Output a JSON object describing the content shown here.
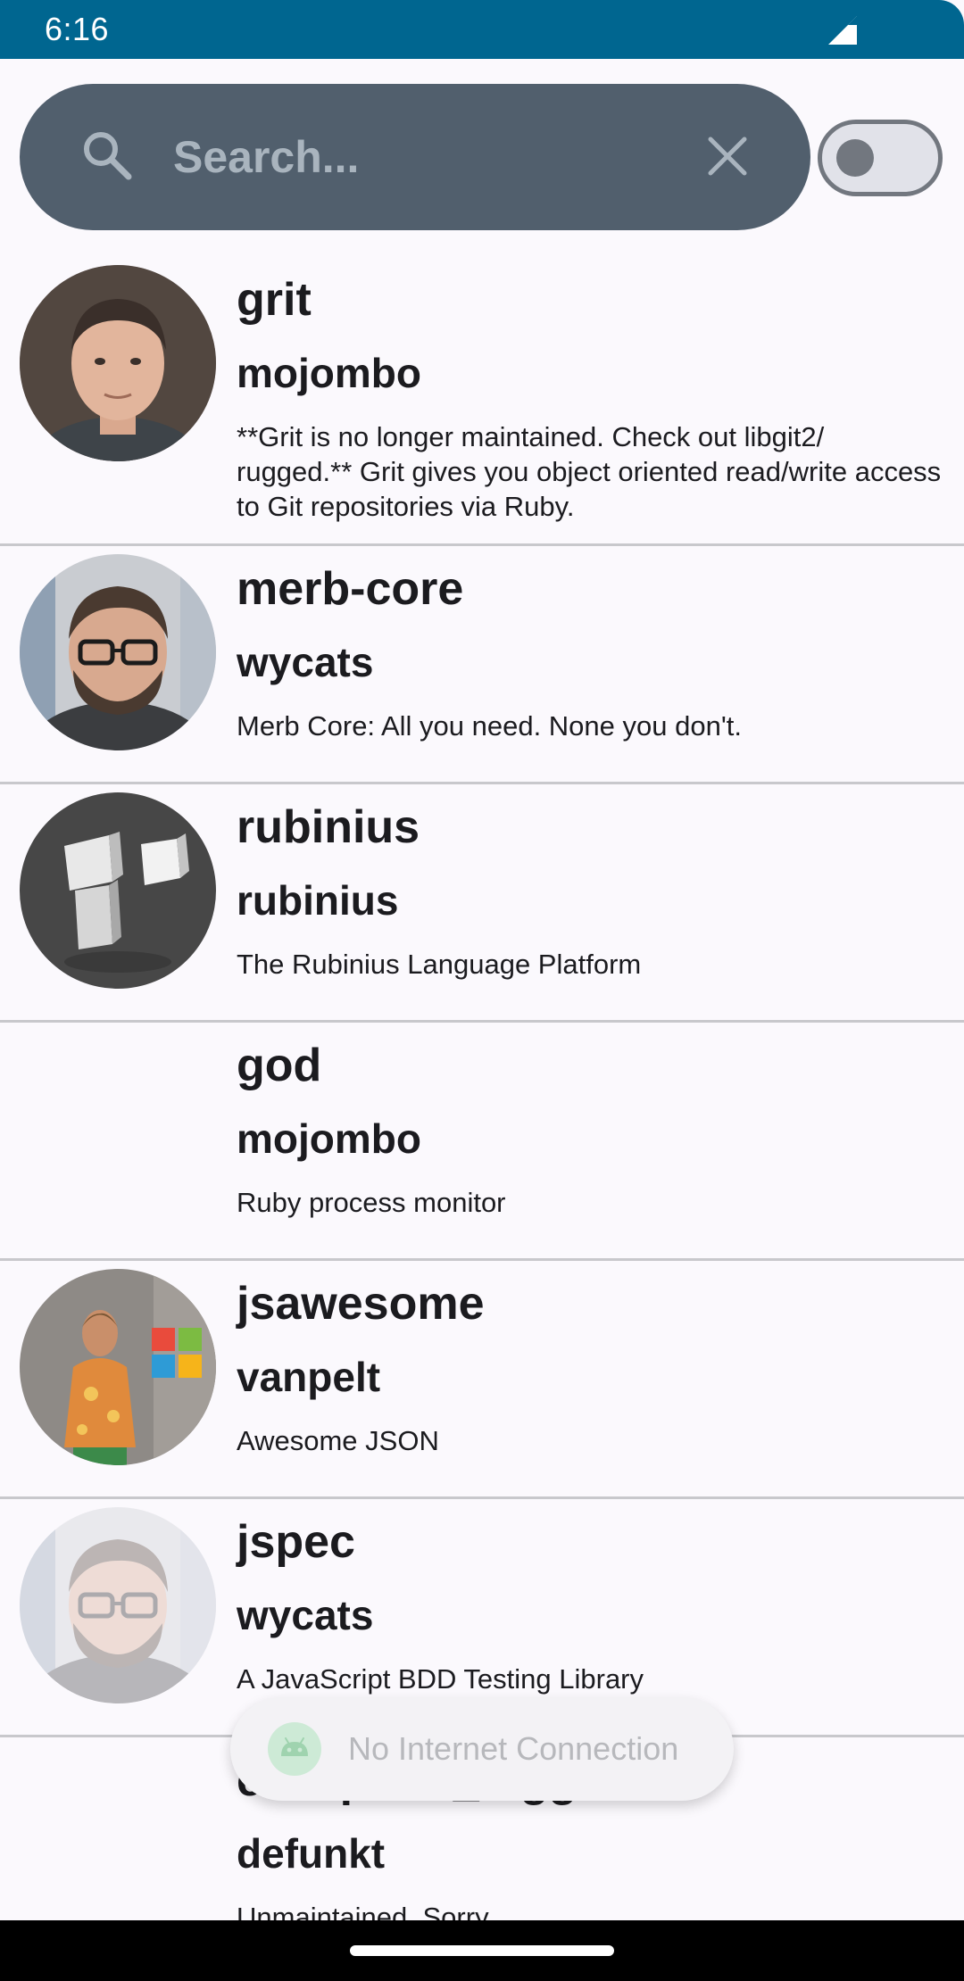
{
  "status_bar": {
    "time": "6:16",
    "color": "#006690"
  },
  "search": {
    "placeholder": "Search...",
    "value": ""
  },
  "toggle": {
    "checked": false
  },
  "repos": [
    {
      "name": "grit",
      "owner": "mojombo",
      "description": "**Grit is no longer maintained. Check out libgit2/ rugged.** Grit gives you object oriented read/write access to Git repositories via Ruby."
    },
    {
      "name": "merb-core",
      "owner": "wycats",
      "description": "Merb Core: All you need. None you don't."
    },
    {
      "name": "rubinius",
      "owner": "rubinius",
      "description": "The Rubinius Language Platform"
    },
    {
      "name": "god",
      "owner": "mojombo",
      "description": "Ruby process monitor"
    },
    {
      "name": "jsawesome",
      "owner": "vanpelt",
      "description": "Awesome JSON"
    },
    {
      "name": "jspec",
      "owner": "wycats",
      "description": "A JavaScript BDD Testing Library"
    },
    {
      "name": "exception_logger",
      "owner": "defunkt",
      "description": "Unmaintained. Sorry."
    }
  ],
  "toast": {
    "message": "No Internet Connection"
  },
  "colors": {
    "background": "#FBF9FD",
    "search_bar": "#515F6D",
    "divider": "#C8C8CC"
  }
}
